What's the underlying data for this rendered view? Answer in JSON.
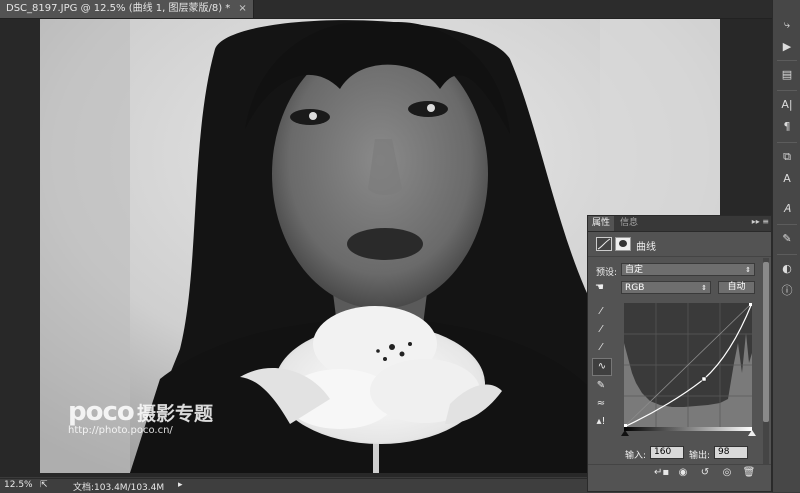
{
  "document_tab": {
    "title": "DSC_8197.JPG @ 12.5% (曲线 1, 图层蒙版/8) *",
    "close": "×"
  },
  "watermark": {
    "brand": "poco",
    "brand_cn": "摄影专题",
    "url": "http://photo.poco.cn/"
  },
  "status_bar": {
    "zoom": "12.5%",
    "doc_info": "文档:103.4M/103.4M"
  },
  "panel": {
    "tabs": [
      {
        "label": "属性"
      },
      {
        "label": "信息"
      }
    ],
    "menu_glyph": "▸▸ ≡",
    "title": "曲线",
    "preset_label": "预设:",
    "preset_value": "自定",
    "channel_value": "RGB",
    "auto_label": "自动",
    "input_label": "输入:",
    "input_value": "160",
    "output_label": "输出:",
    "output_value": "98"
  },
  "colors": {
    "panel_bg": "#535353",
    "tab_bar": "#2c2c2c",
    "toolbar": "#474747"
  },
  "icons": {
    "right_toolbar": [
      "history-icon",
      "play-icon",
      "layers-icon",
      "character-icon",
      "paragraph-icon",
      "clone-source-icon",
      "char-styles-icon",
      "glyph-icon",
      "brush-presets-icon",
      "adjustments-icon",
      "info-icon"
    ],
    "panel_tools": [
      "sample-black-icon",
      "sample-gray-icon",
      "sample-white-icon",
      "curve-points-icon",
      "pencil-icon",
      "smooth-icon",
      "clipping-warning-icon"
    ],
    "panel_footer": [
      "clip-to-layer-icon",
      "view-previous-icon",
      "reset-icon",
      "visibility-icon",
      "delete-icon"
    ]
  }
}
